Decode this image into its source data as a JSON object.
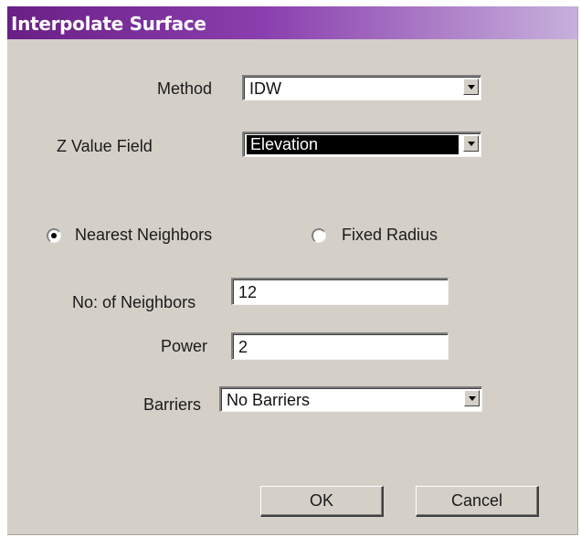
{
  "window": {
    "title": "Interpolate Surface"
  },
  "method": {
    "label": "Method",
    "value": "IDW"
  },
  "z_value_field": {
    "label": "Z Value Field",
    "value": "Elevation"
  },
  "search": {
    "options": [
      {
        "label": "Nearest Neighbors",
        "checked": true
      },
      {
        "label": "Fixed Radius",
        "checked": false
      }
    ]
  },
  "neighbors": {
    "label": "No: of Neighbors",
    "value": "12"
  },
  "power": {
    "label": "Power",
    "value": "2"
  },
  "barriers": {
    "label": "Barriers",
    "value": "No Barriers"
  },
  "buttons": {
    "ok": "OK",
    "cancel": "Cancel"
  },
  "colors": {
    "titlebar_start": "#6a1f86",
    "titlebar_end": "#c7b0dc",
    "dialog_bg": "#d4d0c8"
  }
}
